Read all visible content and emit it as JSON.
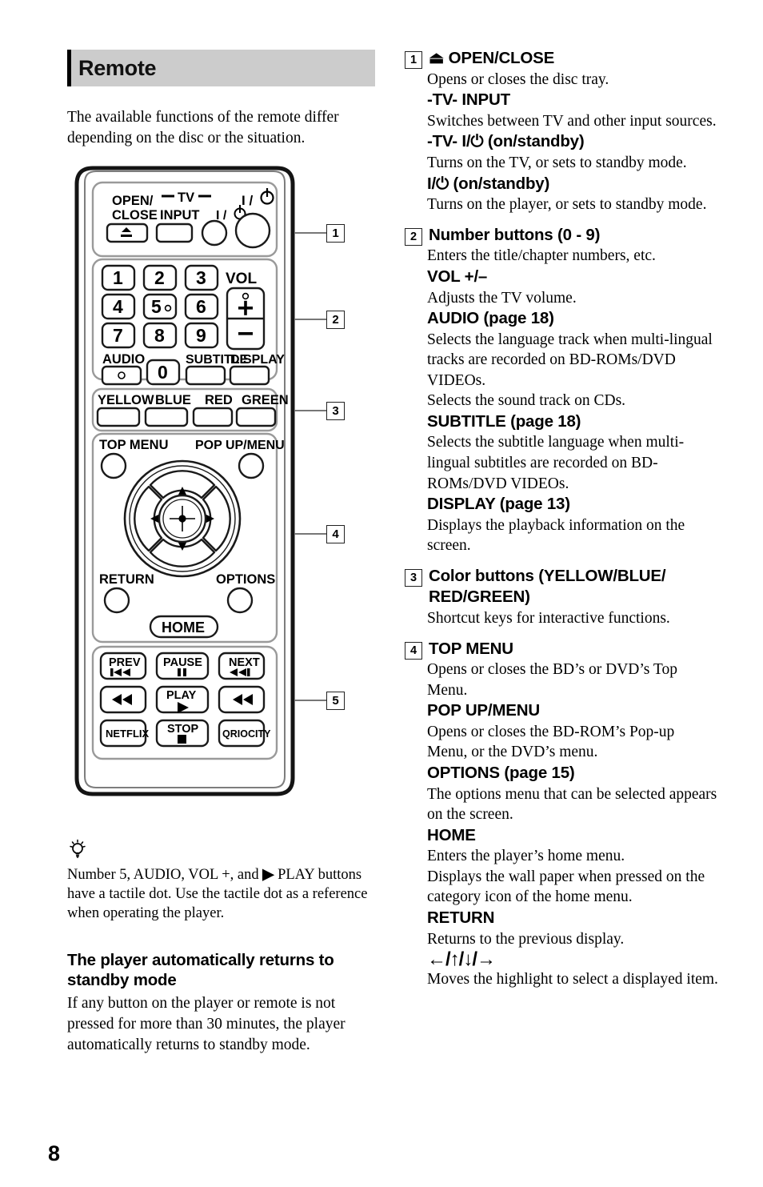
{
  "page": {
    "folio": "8"
  },
  "section": {
    "title": "Remote",
    "intro": "The available functions of the remote differ depending on the disc or the situation."
  },
  "remote": {
    "callouts": [
      "1",
      "2",
      "3",
      "4",
      "5"
    ],
    "top_row": {
      "open_close_label_line1": "OPEN/",
      "open_close_label_line2": "CLOSE",
      "tv_group_label": "TV",
      "input_label": "INPUT",
      "tv_power_glyph": "I/⏻",
      "player_power_glyph": "I/⏻",
      "eject_icon": "eject-icon"
    },
    "numbers": [
      "1",
      "2",
      "3",
      "4",
      "5",
      "6",
      "7",
      "8",
      "9",
      "0"
    ],
    "vol_label": "VOL",
    "vol_plus": "+",
    "vol_minus": "–",
    "audio_label": "AUDIO",
    "subtitle_label": "SUBTITLE",
    "display_label": "DISPLAY",
    "color_buttons": [
      "YELLOW",
      "BLUE",
      "RED",
      "GREEN"
    ],
    "top_menu_label": "TOP MENU",
    "pop_up_menu_label": "POP UP/MENU",
    "return_label": "RETURN",
    "options_label": "OPTIONS",
    "home_label": "HOME",
    "transport": {
      "prev_label": "PREV",
      "pause_label": "PAUSE",
      "next_label": "NEXT",
      "play_label": "PLAY",
      "stop_label": "STOP",
      "netflix_label": "NETFLIX",
      "qriocity_label": "QRIOCITY"
    }
  },
  "tip": {
    "icon": "lightbulb-tip-icon",
    "text_before_glyph": "Number 5, AUDIO, VOL +, and",
    "play_glyph": "▶",
    "text_after_glyph": "PLAY buttons have a tactile dot. Use the tactile dot as a reference when operating the player."
  },
  "standby_note": {
    "heading": "The player automatically returns to standby mode",
    "body": "If any button on the player or remote is not pressed for more than 30 minutes, the player automatically returns to standby mode."
  },
  "entries": [
    {
      "num": "1",
      "title": "⏏ OPEN/CLOSE",
      "desc": "Opens or closes the disc tray.",
      "sub": [
        {
          "title": "-TV- INPUT",
          "desc": "Switches between TV and other input sources."
        },
        {
          "title": "-TV- I/⏻ (on/standby)",
          "desc": "Turns on the TV, or sets to standby mode."
        },
        {
          "title": "I/⏻ (on/standby)",
          "desc": "Turns on the player, or sets to standby mode."
        }
      ]
    },
    {
      "num": "2",
      "title": "Number buttons (0 - 9)",
      "desc": "Enters the title/chapter numbers, etc.",
      "sub": [
        {
          "title": "VOL +/–",
          "desc": "Adjusts the TV volume."
        },
        {
          "title": "AUDIO (page 18)",
          "desc": "Selects the language track when multi-lingual tracks are recorded on BD-ROMs/DVD VIDEOs.\nSelects the sound track on CDs."
        },
        {
          "title": "SUBTITLE (page 18)",
          "desc": "Selects the subtitle language when multi-lingual subtitles are recorded on BD-ROMs/DVD VIDEOs."
        },
        {
          "title": "DISPLAY (page 13)",
          "desc": "Displays the playback information on the screen."
        }
      ]
    },
    {
      "num": "3",
      "title": "Color buttons (YELLOW/BLUE/ RED/GREEN)",
      "desc": "Shortcut keys for interactive functions.",
      "sub": []
    },
    {
      "num": "4",
      "title": "TOP MENU",
      "desc": "Opens or closes the BD’s or DVD’s Top Menu.",
      "sub": [
        {
          "title": "POP UP/MENU",
          "desc": "Opens or closes the BD-ROM’s Pop-up Menu, or the DVD’s menu."
        },
        {
          "title": "OPTIONS (page 15)",
          "desc": "The options menu that can be selected appears on the screen."
        },
        {
          "title": "HOME",
          "desc": "Enters the player’s home menu.\nDisplays the wall paper when pressed on the category icon of the home menu."
        },
        {
          "title": "RETURN",
          "desc": "Returns to the previous display."
        },
        {
          "title": "←/↑/↓/→",
          "desc": "Moves the highlight to select a displayed item."
        }
      ]
    }
  ]
}
